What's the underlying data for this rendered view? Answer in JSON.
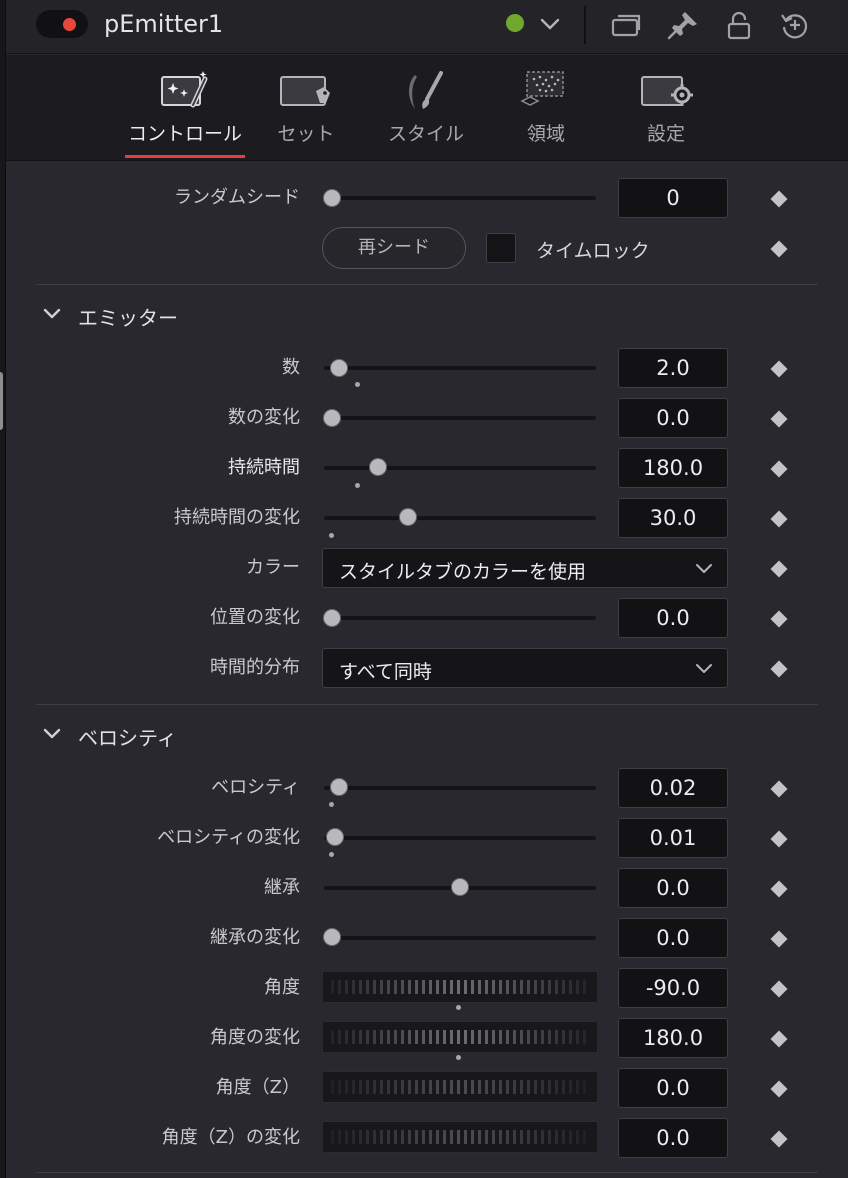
{
  "header": {
    "node_name": "pEmitter1",
    "power": "on",
    "status_color": "#6fa82d",
    "icons": [
      "pop-out-icon",
      "pin-icon",
      "lock-icon",
      "reset-icon"
    ]
  },
  "tabs": [
    {
      "label": "コントロール",
      "icon": "magic-wand-icon",
      "active": true
    },
    {
      "label": "セット",
      "icon": "tag-icon",
      "active": false
    },
    {
      "label": "スタイル",
      "icon": "brush-icon",
      "active": false
    },
    {
      "label": "領域",
      "icon": "region-icon",
      "active": false
    },
    {
      "label": "設定",
      "icon": "settings-icon",
      "active": false
    }
  ],
  "top": {
    "random_seed": {
      "label": "ランダムシード",
      "value": "0",
      "level": 0.0
    },
    "reseed_label": "再シード",
    "timelock_label": "タイムロック",
    "timelock_checked": false
  },
  "emitter": {
    "title": "エミッター",
    "number": {
      "label": "数",
      "value": "2.0"
    },
    "number_variance": {
      "label": "数の変化",
      "value": "0.0"
    },
    "lifespan": {
      "label": "持続時間",
      "value": "180.0"
    },
    "lifespan_variance": {
      "label": "持続時間の変化",
      "value": "30.0"
    },
    "color": {
      "label": "カラー",
      "selected": "スタイルタブのカラーを使用"
    },
    "position_variance": {
      "label": "位置の変化",
      "value": "0.0"
    },
    "temporal_distribution": {
      "label": "時間的分布",
      "selected": "すべて同時"
    }
  },
  "velocity": {
    "title": "ベロシティ",
    "velocity": {
      "label": "ベロシティ",
      "value": "0.02"
    },
    "velocity_variance": {
      "label": "ベロシティの変化",
      "value": "0.01"
    },
    "inherit": {
      "label": "継承",
      "value": "0.0"
    },
    "inherit_variance": {
      "label": "継承の変化",
      "value": "0.0"
    },
    "angle": {
      "label": "角度",
      "value": "-90.0"
    },
    "angle_variance": {
      "label": "角度の変化",
      "value": "180.0"
    },
    "angle_z": {
      "label": "角度（Z）",
      "value": "0.0"
    },
    "angle_z_variance": {
      "label": "角度（Z）の変化",
      "value": "0.0"
    }
  }
}
